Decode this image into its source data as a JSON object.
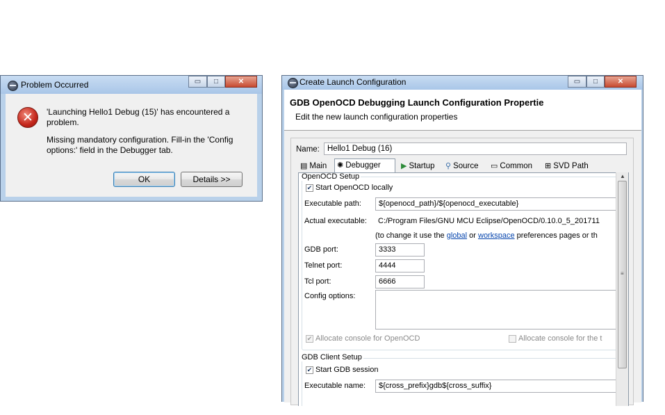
{
  "problem_dialog": {
    "title": "Problem Occurred",
    "message_line1": "'Launching Hello1 Debug (15)' has encountered a",
    "message_line2": "problem.",
    "detail_line1": "Missing mandatory configuration. Fill-in the 'Config",
    "detail_line2": "options:' field in the Debugger tab.",
    "ok_label": "OK",
    "details_label": "Details >>",
    "icon": "error-icon"
  },
  "launch_dialog": {
    "title": "Create Launch Configuration",
    "header_title": "GDB OpenOCD Debugging Launch Configuration Propertie",
    "header_subtitle": "Edit the new launch configuration properties",
    "name_label": "Name:",
    "name_value": "Hello1 Debug (16)",
    "tabs": [
      {
        "label": "Main",
        "icon": "main-tab-icon"
      },
      {
        "label": "Debugger",
        "icon": "debugger-tab-icon"
      },
      {
        "label": "Startup",
        "icon": "startup-tab-icon"
      },
      {
        "label": "Source",
        "icon": "source-tab-icon"
      },
      {
        "label": "Common",
        "icon": "common-tab-icon"
      },
      {
        "label": "SVD Path",
        "icon": "svd-tab-icon"
      }
    ],
    "openocd": {
      "group_title": "OpenOCD Setup",
      "start_locally_label": "Start OpenOCD locally",
      "start_locally_checked": true,
      "exec_path_label": "Executable path:",
      "exec_path_value": "${openocd_path}/${openocd_executable}",
      "actual_exec_label": "Actual executable:",
      "actual_exec_value": "C:/Program Files/GNU MCU Eclipse/OpenOCD/0.10.0_5_201711",
      "hint_prefix": "(to change it use the ",
      "hint_global": "global",
      "hint_or": " or ",
      "hint_workspace": "workspace",
      "hint_suffix": " preferences pages or th",
      "gdb_port_label": "GDB port:",
      "gdb_port_value": "3333",
      "telnet_port_label": "Telnet port:",
      "telnet_port_value": "4444",
      "tcl_port_label": "Tcl port:",
      "tcl_port_value": "6666",
      "config_options_label": "Config options:",
      "config_options_value": "",
      "allocate_console_label": "Allocate console for OpenOCD",
      "allocate_console_checked": true,
      "allocate_console_t_label": "Allocate console for the t",
      "allocate_console_t_checked": false
    },
    "gdb_client": {
      "group_title": "GDB Client Setup",
      "start_session_label": "Start GDB session",
      "start_session_checked": true,
      "exec_name_label": "Executable name:",
      "exec_name_value": "${cross_prefix}gdb${cross_suffix}"
    }
  },
  "window_controls": {
    "minimize": "▭",
    "maximize": "□",
    "close": "✕"
  },
  "colors": {
    "link": "#0645ad",
    "error_red": "#c4261b"
  }
}
